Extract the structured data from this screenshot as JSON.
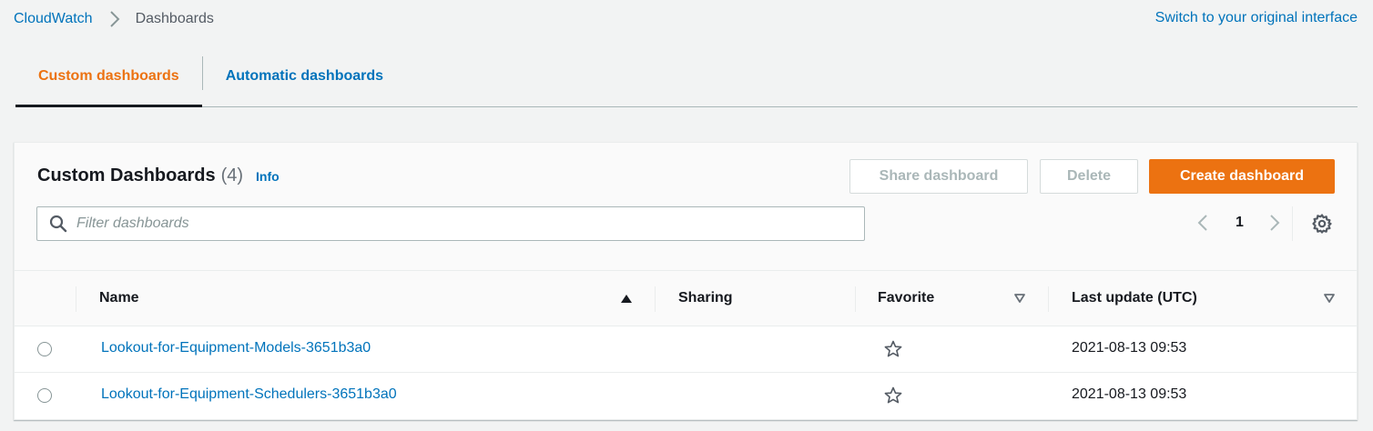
{
  "breadcrumb": {
    "root": "CloudWatch",
    "current": "Dashboards"
  },
  "switch_interface": "Switch to your original interface",
  "tabs": [
    {
      "label": "Custom dashboards",
      "active": true
    },
    {
      "label": "Automatic dashboards",
      "active": false
    }
  ],
  "panel": {
    "title": "Custom Dashboards",
    "count": "(4)",
    "info": "Info",
    "buttons": {
      "share": "Share dashboard",
      "delete": "Delete",
      "create": "Create dashboard"
    },
    "filter_placeholder": "Filter dashboards",
    "pagination": {
      "current_page": "1"
    }
  },
  "table": {
    "columns": {
      "name": "Name",
      "sharing": "Sharing",
      "favorite": "Favorite",
      "last_update": "Last update (UTC)"
    },
    "rows": [
      {
        "name": "Lookout-for-Equipment-Models-3651b3a0",
        "sharing": "",
        "last_update": "2021-08-13 09:53"
      },
      {
        "name": "Lookout-for-Equipment-Schedulers-3651b3a0",
        "sharing": "",
        "last_update": "2021-08-13 09:53"
      }
    ]
  },
  "colors": {
    "link": "#0073bb",
    "accent": "#ec7211",
    "text": "#16191f",
    "disabled_text": "#aab7b8",
    "page_bg": "#f2f3f3"
  },
  "icons": {
    "breadcrumb_separator": "chevron-right-icon",
    "filter": "search-icon",
    "prev_page": "chevron-left-icon",
    "next_page": "chevron-right-icon",
    "settings": "gear-icon",
    "sort_ascending": "caret-up-icon",
    "sortable": "caret-down-outline-icon",
    "favorite": "star-outline-icon"
  }
}
